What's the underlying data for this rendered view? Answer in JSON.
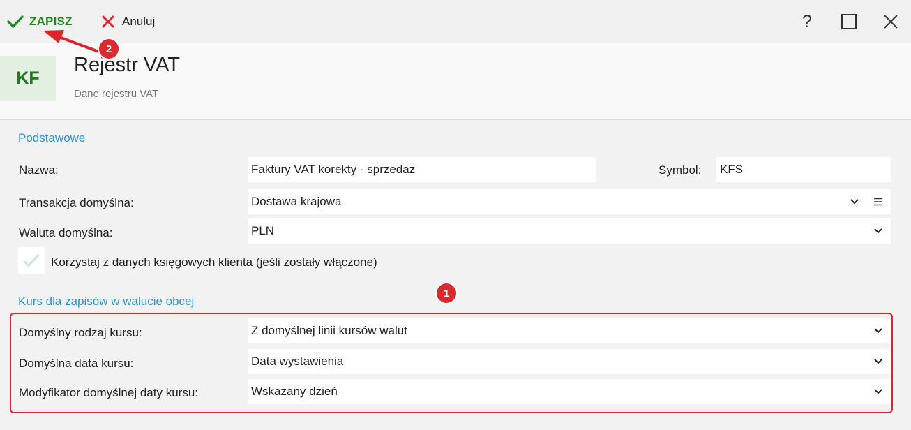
{
  "toolbar": {
    "save_label": "ZAPISZ",
    "cancel_label": "Anuluj",
    "help_label": "?"
  },
  "header": {
    "avatar_text": "KF",
    "title": "Rejestr VAT",
    "subtitle": "Dane rejestru VAT"
  },
  "basic": {
    "section_title": "Podstawowe",
    "name_label": "Nazwa:",
    "name_value": "Faktury VAT korekty - sprzedaż",
    "symbol_label": "Symbol:",
    "symbol_value": "KFS",
    "transaction_label": "Transakcja domyślna:",
    "transaction_value": "Dostawa krajowa",
    "currency_label": "Waluta domyślna:",
    "currency_value": "PLN",
    "checkbox_label": "Korzystaj z danych księgowych klienta (jeśli zostały włączone)",
    "checkbox_checked": false
  },
  "rate": {
    "section_title": "Kurs dla zapisów w walucie obcej",
    "type_label": "Domyślny rodzaj kursu:",
    "type_value": "Z domyślnej linii kursów walut",
    "date_label": "Domyślna data kursu:",
    "date_value": "Data wystawienia",
    "modifier_label": "Modyfikator domyślnej daty kursu:",
    "modifier_value": "Wskazany dzień"
  },
  "annotations": {
    "badge1": "1",
    "badge2": "2"
  },
  "colors": {
    "accent_green": "#1f8a1f",
    "section_blue": "#2f93c9",
    "annotation_red": "#e0242c"
  },
  "icons": [
    "check-icon",
    "x-icon",
    "help-icon",
    "maximize-icon",
    "close-icon",
    "chevron-down-icon",
    "menu-icon",
    "checkbox-check-icon",
    "arrow-annotation"
  ]
}
